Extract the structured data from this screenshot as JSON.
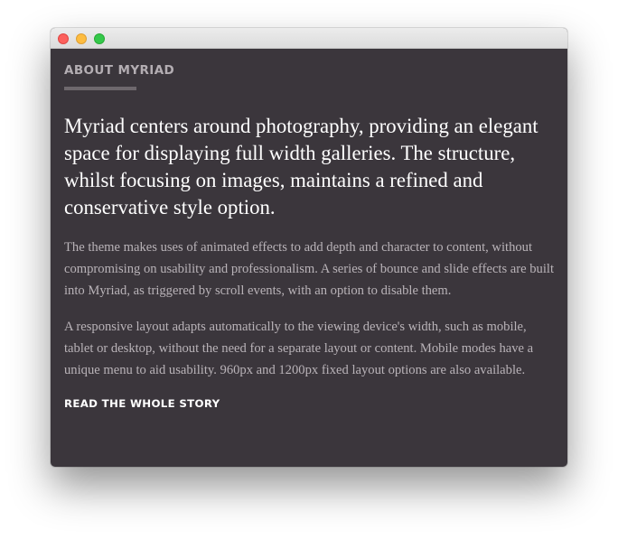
{
  "window": {
    "controls": [
      "close",
      "minimize",
      "maximize"
    ]
  },
  "about": {
    "heading": "ABOUT MYRIAD",
    "lead": "Myriad centers around photography, providing an elegant space for displaying full width galleries. The structure, whilst focusing on images, maintains a refined and conservative style option.",
    "paragraphs": [
      "The theme makes uses of animated effects to add depth and character to content, without compromising on usability and professionalism. A series of bounce and slide effects are built into Myriad, as triggered by scroll events, with an option to disable them.",
      "A responsive layout adapts automatically to the viewing device's width, such as mobile, tablet or desktop, without the need for a separate layout or content. Mobile modes have a unique menu to aid usability. 960px and 1200px fixed layout options are also available."
    ],
    "read_more": "READ THE WHOLE STORY"
  },
  "colors": {
    "background": "#3b363c",
    "heading": "#b4aeb3",
    "lead": "#ffffff",
    "body": "#b9b3b8",
    "accent_rule": "#6e686d"
  }
}
